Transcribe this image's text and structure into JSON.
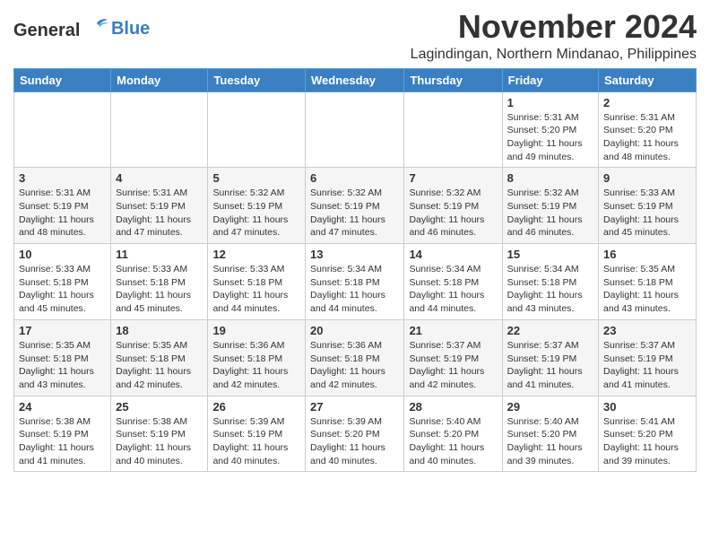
{
  "header": {
    "logo_general": "General",
    "logo_blue": "Blue",
    "month_title": "November 2024",
    "location": "Lagindingan, Northern Mindanao, Philippines"
  },
  "weekdays": [
    "Sunday",
    "Monday",
    "Tuesday",
    "Wednesday",
    "Thursday",
    "Friday",
    "Saturday"
  ],
  "weeks": [
    [
      {
        "day": "",
        "info": ""
      },
      {
        "day": "",
        "info": ""
      },
      {
        "day": "",
        "info": ""
      },
      {
        "day": "",
        "info": ""
      },
      {
        "day": "",
        "info": ""
      },
      {
        "day": "1",
        "info": "Sunrise: 5:31 AM\nSunset: 5:20 PM\nDaylight: 11 hours and 49 minutes."
      },
      {
        "day": "2",
        "info": "Sunrise: 5:31 AM\nSunset: 5:20 PM\nDaylight: 11 hours and 48 minutes."
      }
    ],
    [
      {
        "day": "3",
        "info": "Sunrise: 5:31 AM\nSunset: 5:19 PM\nDaylight: 11 hours and 48 minutes."
      },
      {
        "day": "4",
        "info": "Sunrise: 5:31 AM\nSunset: 5:19 PM\nDaylight: 11 hours and 47 minutes."
      },
      {
        "day": "5",
        "info": "Sunrise: 5:32 AM\nSunset: 5:19 PM\nDaylight: 11 hours and 47 minutes."
      },
      {
        "day": "6",
        "info": "Sunrise: 5:32 AM\nSunset: 5:19 PM\nDaylight: 11 hours and 47 minutes."
      },
      {
        "day": "7",
        "info": "Sunrise: 5:32 AM\nSunset: 5:19 PM\nDaylight: 11 hours and 46 minutes."
      },
      {
        "day": "8",
        "info": "Sunrise: 5:32 AM\nSunset: 5:19 PM\nDaylight: 11 hours and 46 minutes."
      },
      {
        "day": "9",
        "info": "Sunrise: 5:33 AM\nSunset: 5:19 PM\nDaylight: 11 hours and 45 minutes."
      }
    ],
    [
      {
        "day": "10",
        "info": "Sunrise: 5:33 AM\nSunset: 5:18 PM\nDaylight: 11 hours and 45 minutes."
      },
      {
        "day": "11",
        "info": "Sunrise: 5:33 AM\nSunset: 5:18 PM\nDaylight: 11 hours and 45 minutes."
      },
      {
        "day": "12",
        "info": "Sunrise: 5:33 AM\nSunset: 5:18 PM\nDaylight: 11 hours and 44 minutes."
      },
      {
        "day": "13",
        "info": "Sunrise: 5:34 AM\nSunset: 5:18 PM\nDaylight: 11 hours and 44 minutes."
      },
      {
        "day": "14",
        "info": "Sunrise: 5:34 AM\nSunset: 5:18 PM\nDaylight: 11 hours and 44 minutes."
      },
      {
        "day": "15",
        "info": "Sunrise: 5:34 AM\nSunset: 5:18 PM\nDaylight: 11 hours and 43 minutes."
      },
      {
        "day": "16",
        "info": "Sunrise: 5:35 AM\nSunset: 5:18 PM\nDaylight: 11 hours and 43 minutes."
      }
    ],
    [
      {
        "day": "17",
        "info": "Sunrise: 5:35 AM\nSunset: 5:18 PM\nDaylight: 11 hours and 43 minutes."
      },
      {
        "day": "18",
        "info": "Sunrise: 5:35 AM\nSunset: 5:18 PM\nDaylight: 11 hours and 42 minutes."
      },
      {
        "day": "19",
        "info": "Sunrise: 5:36 AM\nSunset: 5:18 PM\nDaylight: 11 hours and 42 minutes."
      },
      {
        "day": "20",
        "info": "Sunrise: 5:36 AM\nSunset: 5:18 PM\nDaylight: 11 hours and 42 minutes."
      },
      {
        "day": "21",
        "info": "Sunrise: 5:37 AM\nSunset: 5:19 PM\nDaylight: 11 hours and 42 minutes."
      },
      {
        "day": "22",
        "info": "Sunrise: 5:37 AM\nSunset: 5:19 PM\nDaylight: 11 hours and 41 minutes."
      },
      {
        "day": "23",
        "info": "Sunrise: 5:37 AM\nSunset: 5:19 PM\nDaylight: 11 hours and 41 minutes."
      }
    ],
    [
      {
        "day": "24",
        "info": "Sunrise: 5:38 AM\nSunset: 5:19 PM\nDaylight: 11 hours and 41 minutes."
      },
      {
        "day": "25",
        "info": "Sunrise: 5:38 AM\nSunset: 5:19 PM\nDaylight: 11 hours and 40 minutes."
      },
      {
        "day": "26",
        "info": "Sunrise: 5:39 AM\nSunset: 5:19 PM\nDaylight: 11 hours and 40 minutes."
      },
      {
        "day": "27",
        "info": "Sunrise: 5:39 AM\nSunset: 5:20 PM\nDaylight: 11 hours and 40 minutes."
      },
      {
        "day": "28",
        "info": "Sunrise: 5:40 AM\nSunset: 5:20 PM\nDaylight: 11 hours and 40 minutes."
      },
      {
        "day": "29",
        "info": "Sunrise: 5:40 AM\nSunset: 5:20 PM\nDaylight: 11 hours and 39 minutes."
      },
      {
        "day": "30",
        "info": "Sunrise: 5:41 AM\nSunset: 5:20 PM\nDaylight: 11 hours and 39 minutes."
      }
    ]
  ]
}
